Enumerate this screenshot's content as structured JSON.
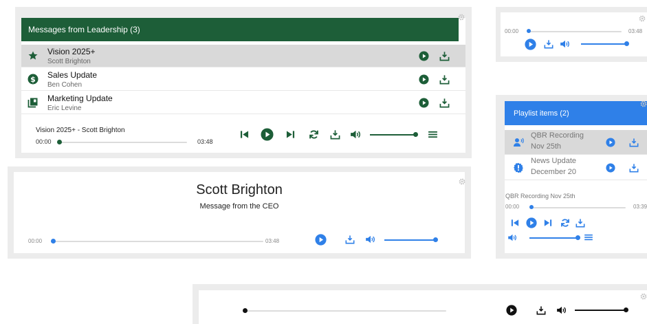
{
  "colors": {
    "green": "#1d5e38",
    "blue": "#2f80e8",
    "panel": "#ececec"
  },
  "leadership": {
    "header": "Messages from Leadership (3)",
    "items": [
      {
        "title": "Vision 2025+",
        "author": "Scott Brighton",
        "icon": "star-icon"
      },
      {
        "title": "Sales Update",
        "author": "Ben Cohen",
        "icon": "dollar-icon"
      },
      {
        "title": "Marketing Update",
        "author": "Eric Levine",
        "icon": "book-icon"
      }
    ],
    "now_playing": "Vision 2025+ - Scott Brighton",
    "time_current": "00:00",
    "time_total": "03:48",
    "progress": 0.0,
    "volume": 1.0
  },
  "mini_player": {
    "time_current": "00:00",
    "time_total": "03:48",
    "progress": 0.0,
    "volume": 1.0
  },
  "feature": {
    "name": "Scott Brighton",
    "subtitle": "Message from the CEO",
    "time_current": "00:00",
    "time_total": "03:48",
    "progress": 0.0,
    "volume": 1.0
  },
  "playlist": {
    "header": "Playlist items (2)",
    "items": [
      {
        "title": "QBR Recording",
        "date": "Nov 25th",
        "icon": "speaker-person-icon"
      },
      {
        "title": "News Update",
        "date": "December 20",
        "icon": "badge-icon"
      }
    ],
    "now_playing": "QBR Recording Nov 25th",
    "time_current": "00:00",
    "time_total": "03:39",
    "progress": 0.0,
    "volume": 1.0
  },
  "bottom_player": {
    "progress": 0.0,
    "volume": 1.0
  }
}
